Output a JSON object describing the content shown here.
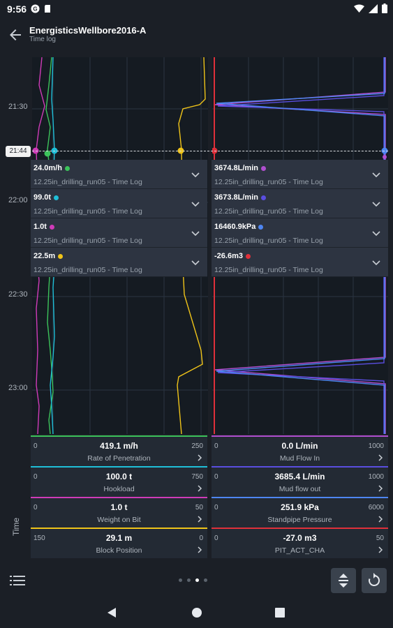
{
  "status_bar": {
    "time": "9:56",
    "icons": [
      "notification-g-icon",
      "sd-card-icon",
      "wifi-icon",
      "signal-icon",
      "battery-icon"
    ]
  },
  "app_bar": {
    "title": "EnergisticsWellbore2016-A",
    "subtitle": "Time log"
  },
  "time_axis": {
    "ticks": [
      "21:30",
      "22:00",
      "22:30",
      "23:00"
    ],
    "cursor_time": "21:44",
    "label": "Time"
  },
  "readouts_left": [
    {
      "value": "24.0m/h",
      "color": "#3cc35b",
      "source": "12.25in_drilling_run05 - Time Log"
    },
    {
      "value": "99.0t",
      "color": "#1fbfd8",
      "source": "12.25in_drilling_run05 - Time Log"
    },
    {
      "value": "1.0t",
      "color": "#cf3bb8",
      "source": "12.25in_drilling_run05 - Time Log"
    },
    {
      "value": "22.5m",
      "color": "#f0c419",
      "source": "12.25in_drilling_run05 - Time Log"
    }
  ],
  "readouts_right": [
    {
      "value": "3674.8L/min",
      "color": "#b04fcf",
      "source": "12.25in_drilling_run05 - Time Log"
    },
    {
      "value": "3673.8L/min",
      "color": "#5a4ee0",
      "source": "12.25in_drilling_run05 - Time Log"
    },
    {
      "value": "16460.9kPa",
      "color": "#4e86f2",
      "source": "12.25in_drilling_run05 - Time Log"
    },
    {
      "value": "-26.6m3",
      "color": "#e0303a",
      "source": "12.25in_drilling_run05 - Time Log"
    }
  ],
  "gauges_left": [
    {
      "min": "0",
      "value": "419.1 m/h",
      "max": "250",
      "name": "Rate of Penetration",
      "color": "#3cc35b"
    },
    {
      "min": "0",
      "value": "100.0 t",
      "max": "750",
      "name": "Hookload",
      "color": "#1fbfd8"
    },
    {
      "min": "0",
      "value": "1.0 t",
      "max": "50",
      "name": "Weight on Bit",
      "color": "#cf3bb8"
    },
    {
      "min": "150",
      "value": "29.1 m",
      "max": "0",
      "name": "Block Position",
      "color": "#f0c419"
    }
  ],
  "gauges_right": [
    {
      "min": "0",
      "value": "0.0 L/min",
      "max": "1000",
      "name": "Mud Flow In",
      "color": "#b04fcf"
    },
    {
      "min": "0",
      "value": "3685.4 L/min",
      "max": "1000",
      "name": "Mud flow out",
      "color": "#5a4ee0"
    },
    {
      "min": "0",
      "value": "251.9 kPa",
      "max": "6000",
      "name": "Standpipe Pressure",
      "color": "#4e86f2"
    },
    {
      "min": "0",
      "value": "-27.0 m3",
      "max": "50",
      "name": "PIT_ACT_CHA",
      "color": "#e0303a"
    }
  ],
  "pager": {
    "pages": 4,
    "active_index": 2
  },
  "colors": {
    "background": "#1b1f26",
    "plot": "#151b22",
    "card": "#2d3441"
  }
}
